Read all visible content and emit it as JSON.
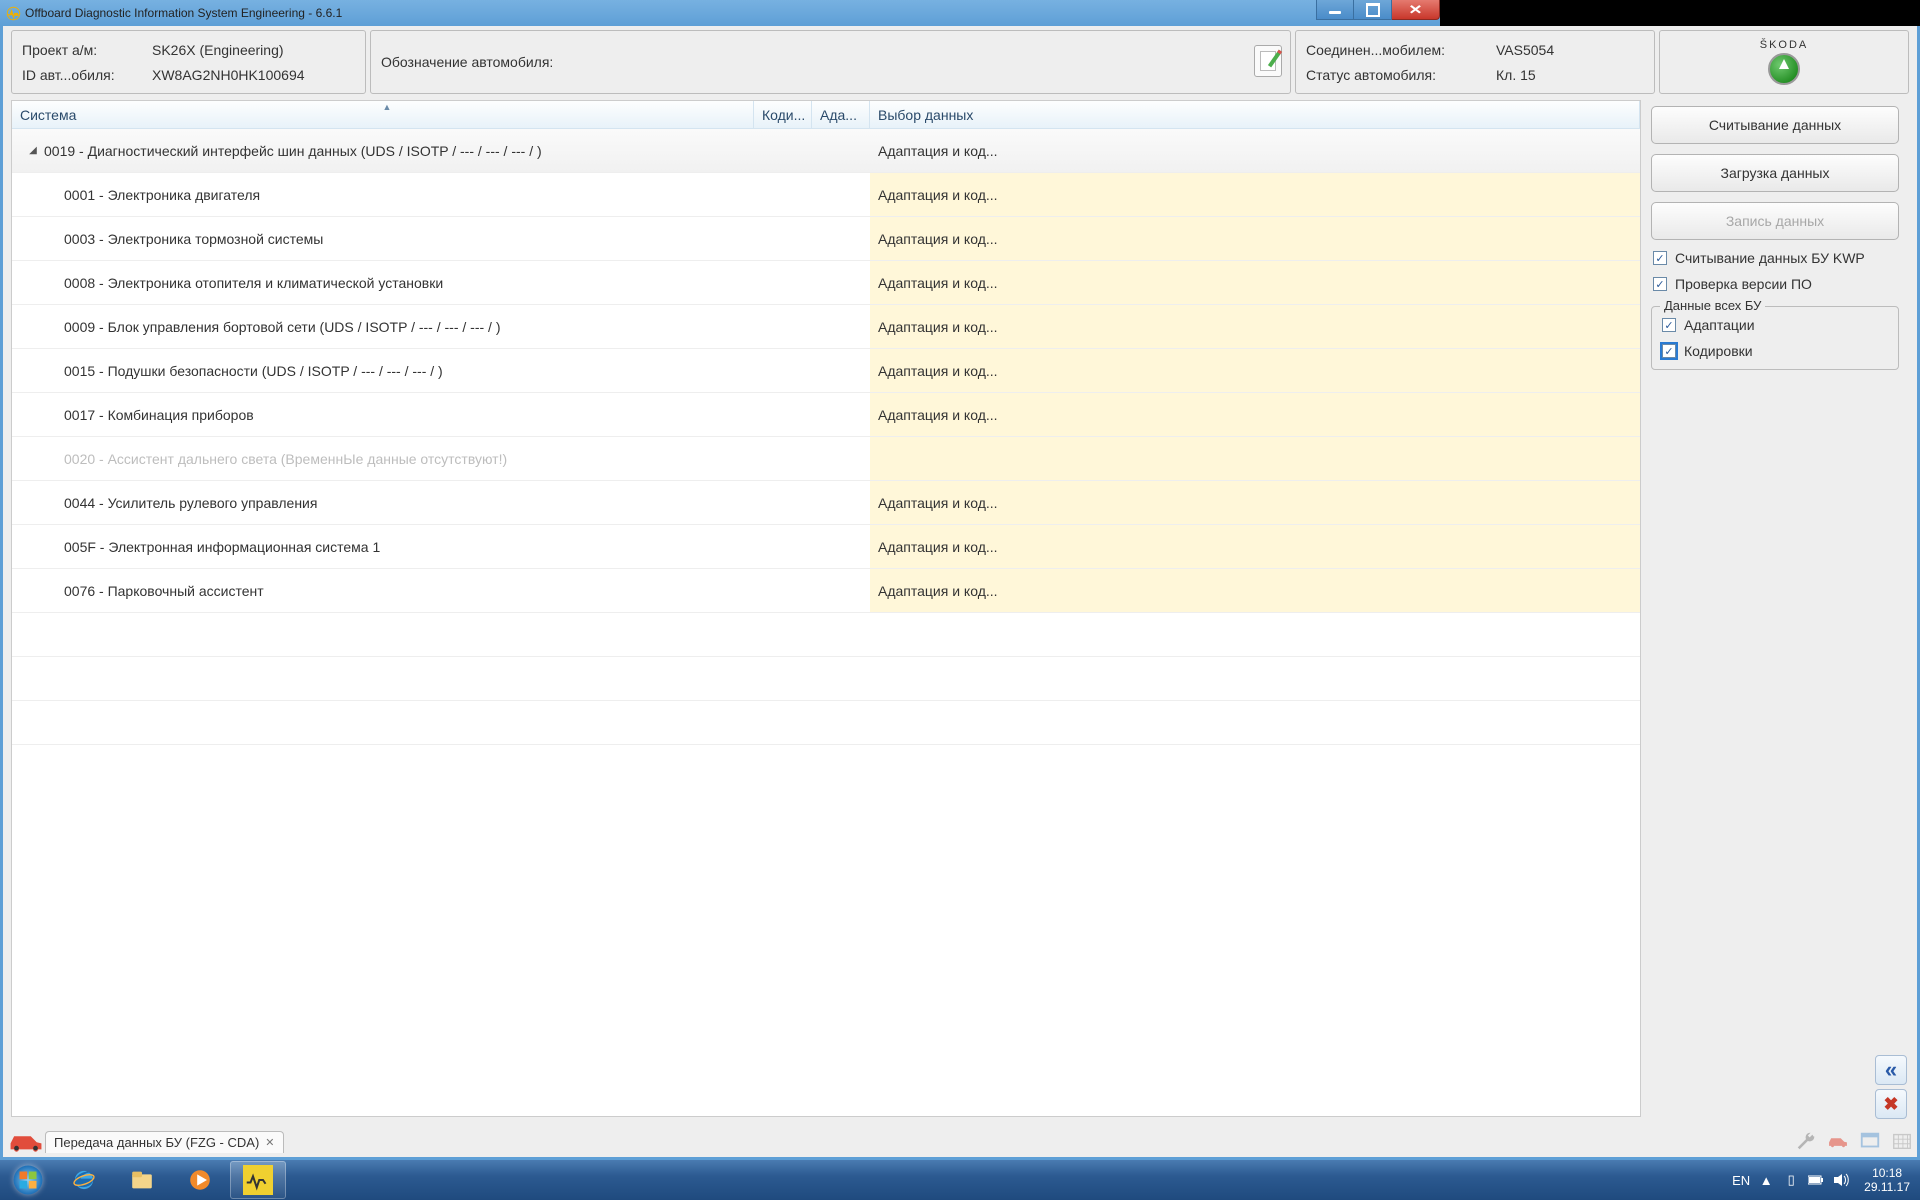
{
  "window": {
    "title": "Offboard Diagnostic Information System Engineering - 6.6.1"
  },
  "info": {
    "box1": {
      "label1": "Проект а/м:",
      "value1": "SK26X     (Engineering)",
      "label2": "ID авт...обиля:",
      "value2": "XW8AG2NH0HK100694"
    },
    "box2": {
      "label1": "Обозначение автомобиля:"
    },
    "box3": {
      "label1": "Соединен...мобилем:",
      "value1": "VAS5054",
      "label2": "Статус автомобиля:",
      "value2": "Кл. 15"
    },
    "brand": "ŠKODA"
  },
  "grid": {
    "headers": {
      "system": "Система",
      "coding": "Коди...",
      "adapt": "Ада...",
      "data": "Выбор данных"
    },
    "parent": {
      "label": "0019 - Диагностический интерфейс шин данных  (UDS / ISOTP / --- / --- / --- /  )",
      "data": "Адаптация и код..."
    },
    "rows": [
      {
        "label": "0001 - Электроника двигателя",
        "data": "Адаптация и код...",
        "disabled": false
      },
      {
        "label": "0003 - Электроника тормозной системы",
        "data": "Адаптация и код...",
        "disabled": false
      },
      {
        "label": "0008 - Электроника отопителя и климатической установки",
        "data": "Адаптация и код...",
        "disabled": false
      },
      {
        "label": "0009 - Блок управления бортовой сети  (UDS / ISOTP / --- / --- / --- /  )",
        "data": "Адаптация и код...",
        "disabled": false
      },
      {
        "label": "0015 - Подушки безопасности  (UDS / ISOTP / --- / --- / --- /  )",
        "data": "Адаптация и код...",
        "disabled": false
      },
      {
        "label": "0017 - Комбинация приборов",
        "data": "Адаптация и код...",
        "disabled": false
      },
      {
        "label": "0020 - Ассистент дальнего света  (ВременнЫе данные отсутствуют!)",
        "data": "",
        "disabled": true
      },
      {
        "label": "0044 - Усилитель рулевого управления",
        "data": "Адаптация и код...",
        "disabled": false
      },
      {
        "label": "005F - Электронная информационная система 1",
        "data": "Адаптация и код...",
        "disabled": false
      },
      {
        "label": "0076 - Парковочный ассистент",
        "data": "Адаптация и код...",
        "disabled": false
      }
    ]
  },
  "side": {
    "btn_read": "Считывание данных",
    "btn_load": "Загрузка данных",
    "btn_write": "Запись данных",
    "chk_kwp": "Считывание данных БУ KWP",
    "chk_ver": "Проверка версии ПО",
    "group_title": "Данные всех БУ",
    "chk_adapt": "Адаптации",
    "chk_coding": "Кодировки"
  },
  "tab": {
    "label": "Передача данных БУ (FZG - CDA)"
  },
  "tray": {
    "lang": "EN",
    "time": "10:18",
    "date": "29.11.17"
  }
}
